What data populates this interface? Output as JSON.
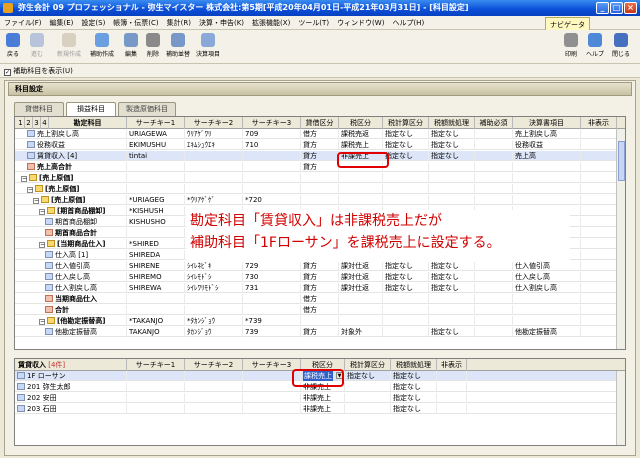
{
  "window": {
    "title": "弥生会計 09 プロフェッショナル - 弥生マイスター 株式会社:第5期[平成20年04月01日-平成21年03月31日] - [科目設定]"
  },
  "menu": [
    "ファイル(F)",
    "編集(E)",
    "設定(S)",
    "帳簿・伝票(C)",
    "集計(R)",
    "決算・申告(K)",
    "拡張機能(X)",
    "ツール(T)",
    "ウィンドウ(W)",
    "ヘルプ(H)"
  ],
  "navigator": "ナビゲータ",
  "toolbar": {
    "left": [
      "戻る",
      "進む",
      "新規作成",
      "補助作成",
      "編集",
      "削除",
      "補助並替",
      "決算項目"
    ],
    "right": [
      "印刷",
      "ヘルプ",
      "閉じる"
    ]
  },
  "show_sub": "補助科目を表示(U)",
  "panel_title": "科目設定",
  "tabs": [
    "貸借科目",
    "損益科目",
    "製造原価科目"
  ],
  "levels": [
    "1",
    "2",
    "3",
    "4"
  ],
  "main_headers": [
    "勘定科目",
    "サーチキー1",
    "サーチキー2",
    "サーチキー3",
    "貸借区分",
    "税区分",
    "税計算区分",
    "税額就処理",
    "補助必須",
    "決算書項目",
    "非表示"
  ],
  "main_rows": [
    {
      "name": "売上割戻し高",
      "k1": "URIAGEWA",
      "k2": "ｳﾘｱｹﾞﾜﾘ",
      "k3": "709",
      "dc": "借方",
      "tax": "課税売返",
      "calc": "指定なし",
      "proc": "指定なし",
      "req": "",
      "fs": "売上割戻し高",
      "hid": ""
    },
    {
      "name": "役務収益",
      "k1": "EKIMUSHU",
      "k2": "ｴｷﾑｼｭｳｴｷ",
      "k3": "710",
      "dc": "貸方",
      "tax": "課税売上",
      "calc": "指定なし",
      "proc": "指定なし",
      "req": "",
      "fs": "役務収益",
      "hid": ""
    },
    {
      "name": "賃貸収入 [4]",
      "k1": "tintai",
      "k2": "",
      "k3": "",
      "dc": "貸方",
      "tax": "非課売上",
      "calc": "指定なし",
      "proc": "指定なし",
      "req": "",
      "fs": "売上高",
      "hid": ""
    },
    {
      "name": "売上高合計",
      "k1": "",
      "k2": "",
      "k3": "",
      "dc": "貸方",
      "tax": "",
      "calc": "",
      "proc": "",
      "req": "",
      "fs": "",
      "hid": ""
    },
    {
      "name": "[売上原価]",
      "k1": "",
      "k2": "",
      "k3": "",
      "dc": "",
      "tax": "",
      "calc": "",
      "proc": "",
      "req": "",
      "fs": "",
      "hid": ""
    },
    {
      "name": "[売上原価]",
      "k1": "",
      "k2": "",
      "k3": "",
      "dc": "",
      "tax": "",
      "calc": "",
      "proc": "",
      "req": "",
      "fs": "",
      "hid": ""
    },
    {
      "name": "[売上原価]",
      "k1": "*URIAGEG",
      "k2": "*ｳﾘｱｹﾞｹﾞ",
      "k3": "*720",
      "dc": "",
      "tax": "",
      "calc": "",
      "proc": "",
      "req": "",
      "fs": "",
      "hid": ""
    },
    {
      "name": "[期首商品棚卸]",
      "k1": "*KISHUSH",
      "k2": "",
      "k3": "",
      "dc": "",
      "tax": "",
      "calc": "",
      "proc": "",
      "req": "",
      "fs": "",
      "hid": ""
    },
    {
      "name": "期首商品棚卸",
      "k1": "KISHUSHO",
      "k2": "",
      "k3": "",
      "dc": "",
      "tax": "",
      "calc": "",
      "proc": "",
      "req": "",
      "fs": "高",
      "hid": ""
    },
    {
      "name": "期首商品合計",
      "k1": "",
      "k2": "",
      "k3": "",
      "dc": "",
      "tax": "",
      "calc": "",
      "proc": "",
      "req": "",
      "fs": "",
      "hid": ""
    },
    {
      "name": "[当期商品仕入]",
      "k1": "*SHIRED",
      "k2": "",
      "k3": "",
      "dc": "",
      "tax": "",
      "calc": "",
      "proc": "",
      "req": "",
      "fs": "",
      "hid": ""
    },
    {
      "name": "仕入高 [1]",
      "k1": "SHIREDA",
      "k2": "",
      "k3": "",
      "dc": "",
      "tax": "",
      "calc": "",
      "proc": "",
      "req": "",
      "fs": "高",
      "hid": ""
    },
    {
      "name": "仕入値引高",
      "k1": "SHIRENE",
      "k2": "ｼｲﾚﾈﾋﾞｷ",
      "k3": "729",
      "dc": "貸方",
      "tax": "課対仕返",
      "calc": "指定なし",
      "proc": "指定なし",
      "req": "",
      "fs": "仕入値引高",
      "hid": ""
    },
    {
      "name": "仕入戻し高",
      "k1": "SHIREMO",
      "k2": "ｼｲﾚﾓﾄﾞｼ",
      "k3": "730",
      "dc": "貸方",
      "tax": "課対仕返",
      "calc": "指定なし",
      "proc": "指定なし",
      "req": "",
      "fs": "仕入戻し高",
      "hid": ""
    },
    {
      "name": "仕入割戻し高",
      "k1": "SHIREWA",
      "k2": "ｼｲﾚﾜﾘﾓﾄﾞｼ",
      "k3": "731",
      "dc": "貸方",
      "tax": "課対仕返",
      "calc": "指定なし",
      "proc": "指定なし",
      "req": "",
      "fs": "仕入割戻し高",
      "hid": ""
    },
    {
      "name": "当期商品仕入",
      "k1": "",
      "k2": "",
      "k3": "",
      "dc": "借方",
      "tax": "",
      "calc": "",
      "proc": "",
      "req": "",
      "fs": "",
      "hid": ""
    },
    {
      "name": "合計",
      "k1": "",
      "k2": "",
      "k3": "",
      "dc": "借方",
      "tax": "",
      "calc": "",
      "proc": "",
      "req": "",
      "fs": "",
      "hid": ""
    },
    {
      "name": "[他勘定振替高]",
      "k1": "*TAKANJO",
      "k2": "*ﾀｶﾝｼﾞｮｳ",
      "k3": "*739",
      "dc": "",
      "tax": "",
      "calc": "",
      "proc": "",
      "req": "",
      "fs": "",
      "hid": ""
    },
    {
      "name": "他勘定振替高",
      "k1": "TAKANJO",
      "k2": "ﾀｶﾝｼﾞｮｳ",
      "k3": "739",
      "dc": "貸方",
      "tax": "対象外",
      "calc": "",
      "proc": "指定なし",
      "req": "",
      "fs": "他勘定振替高",
      "hid": ""
    }
  ],
  "callout": {
    "line1": "勘定科目「賃貸収入」は非課税売上だが",
    "line2": "補助科目「1Fローサン」を課税売上に設定する。"
  },
  "sub_title": "賃貸収入",
  "sub_title_count": "[4件]",
  "sub_headers": [
    "",
    "サーチキー1",
    "サーチキー2",
    "サーチキー3",
    "税区分",
    "税計算区分",
    "税額就処理",
    "非表示"
  ],
  "sub_rows": [
    {
      "name": "1F ローサン",
      "tax": "課税売上",
      "calc": "指定なし",
      "proc": "指定なし"
    },
    {
      "name": "201 弥生太郎",
      "tax": "非課売上",
      "calc": "",
      "proc": "指定なし"
    },
    {
      "name": "202 安田",
      "tax": "非課売上",
      "calc": "",
      "proc": "指定なし"
    },
    {
      "name": "203 石田",
      "tax": "非課売上",
      "calc": "",
      "proc": "指定なし"
    }
  ]
}
